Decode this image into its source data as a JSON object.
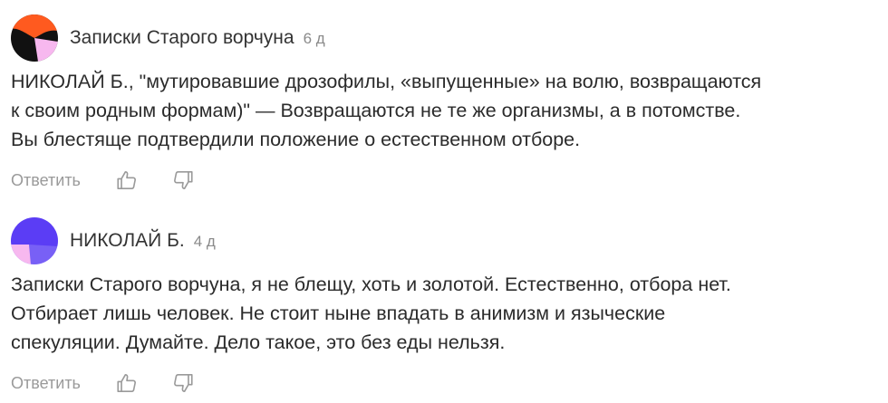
{
  "comments": [
    {
      "author": "Записки Старого ворчуна",
      "time": "6 д",
      "text": "НИКОЛАЙ Б., \"мутировавшие дрозофилы, «выпущенные» на волю, возвращаются\nк своим родным формам)\" — Возвращаются не те же организмы, а в потомстве.\nВы блестяще подтвердили положение о естественном отборе.",
      "reply_label": "Ответить",
      "avatar_colors": [
        "#ff5a1f",
        "#111111",
        "#f7b8ef"
      ]
    },
    {
      "author": "НИКОЛАЙ Б.",
      "time": "4 д",
      "text": "Записки Старого ворчуна, я не блещу, хоть и золотой. Естественно, отбора нет.\nОтбирает лишь человек. Не стоит ныне впадать в анимизм и языческие\nспекуляции. Думайте. Дело такое, это без еды нельзя.",
      "reply_label": "Ответить",
      "avatar_colors": [
        "#5b3df5",
        "#f7b8ef"
      ]
    }
  ],
  "icons": {
    "like": "thumbs-up-icon",
    "dislike": "thumbs-down-icon"
  },
  "colors": {
    "text": "#2b2b2b",
    "muted": "#9a9a9a"
  }
}
